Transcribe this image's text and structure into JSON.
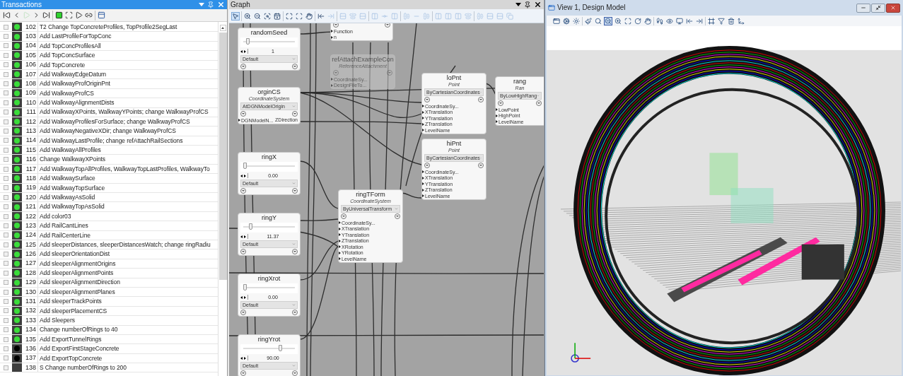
{
  "transactions": {
    "title": "Transactions",
    "toolbar": [
      {
        "disabled": false
      },
      {
        "disabled": false
      },
      {
        "disabled": true
      },
      {
        "disabled": false
      },
      {
        "disabled": false
      },
      {
        "disabled": false
      },
      {
        "disabled": false
      },
      {
        "disabled": false
      },
      {
        "disabled": false
      },
      {
        "disabled": false
      }
    ],
    "rows": [
      {
        "number": "102",
        "text": "T2 Change TopConcreteProfiles, TopProfile2SegLast",
        "color": "#3bdc3b"
      },
      {
        "number": "103",
        "text": "Add LastProfileForTopConc",
        "color": "#3bdc3b"
      },
      {
        "number": "104",
        "text": "Add TopConcProfilesAll",
        "color": "#3bdc3b"
      },
      {
        "number": "105",
        "text": "Add TopConcSurface",
        "color": "#3bdc3b"
      },
      {
        "number": "106",
        "text": "Add TopConcrete",
        "color": "#3bdc3b"
      },
      {
        "number": "107",
        "text": "Add WalkwayEdgeDatum",
        "color": "#3bdc3b"
      },
      {
        "number": "108",
        "text": "Add WalkwayProfOriginPnt",
        "color": "#3bdc3b"
      },
      {
        "number": "109",
        "text": "Add WalkwayProfCS",
        "color": "#3bdc3b"
      },
      {
        "number": "110",
        "text": "Add WalkwayAlignmentDists",
        "color": "#3bdc3b"
      },
      {
        "number": "111",
        "text": "Add WalkwayXPoints, WalkwayYPoints; change WalkwayProfCS",
        "color": "#3bdc3b"
      },
      {
        "number": "112",
        "text": "Add WalkwayProfilesForSurface; change WalkwayProfCS",
        "color": "#3bdc3b"
      },
      {
        "number": "113",
        "text": "Add WalkwayNegativeXDir; change WalkwayProfCS",
        "color": "#3bdc3b"
      },
      {
        "number": "114",
        "text": "Add WalkwayLastProfile; change refAttachRailSections",
        "color": "#3bdc3b"
      },
      {
        "number": "115",
        "text": "Add WalkwayAllProfiles",
        "color": "#3bdc3b"
      },
      {
        "number": "116",
        "text": "Change WalkwayXPoints",
        "color": "#3bdc3b"
      },
      {
        "number": "117",
        "text": "Add WalkwayTopAllProfiles, WalkwayTopLastProfiles, WalkwayTo",
        "color": "#3bdc3b"
      },
      {
        "number": "118",
        "text": "Add WalkwaySurface",
        "color": "#3bdc3b"
      },
      {
        "number": "119",
        "text": "Add WalkwayTopSurface",
        "color": "#3bdc3b"
      },
      {
        "number": "120",
        "text": "Add WalkwayAsSolid",
        "color": "#3bdc3b"
      },
      {
        "number": "121",
        "text": "Add WalkwayTopAsSolid",
        "color": "#3bdc3b"
      },
      {
        "number": "122",
        "text": "Add color03",
        "color": "#3bdc3b"
      },
      {
        "number": "123",
        "text": "Add RailCantLines",
        "color": "#3bdc3b"
      },
      {
        "number": "124",
        "text": "Add RailCenterLine",
        "color": "#3bdc3b"
      },
      {
        "number": "125",
        "text": "Add sleeperDistances, sleeperDistancesWatch; change ringRadiu",
        "color": "#3bdc3b"
      },
      {
        "number": "126",
        "text": "Add sleeperOrientationDist",
        "color": "#3bdc3b"
      },
      {
        "number": "127",
        "text": "Add sleeperAlignmentOrigins",
        "color": "#3bdc3b"
      },
      {
        "number": "128",
        "text": "Add sleeperAlignmentPoints",
        "color": "#3bdc3b"
      },
      {
        "number": "129",
        "text": "Add sleeperAlignmentDirection",
        "color": "#3bdc3b"
      },
      {
        "number": "130",
        "text": "Add sleeperAlignmentPlanes",
        "color": "#3bdc3b"
      },
      {
        "number": "131",
        "text": "Add sleeperTrackPoints",
        "color": "#3bdc3b"
      },
      {
        "number": "132",
        "text": "Add sleeperPlacementCS",
        "color": "#3bdc3b"
      },
      {
        "number": "133",
        "text": "Add Sleepers",
        "color": "#3bdc3b"
      },
      {
        "number": "134",
        "text": "Change numberOfRings to 40",
        "color": "#3bdc3b"
      },
      {
        "number": "135",
        "text": "Add ExportTunnelRings",
        "color": "#3bdc3b"
      },
      {
        "number": "136",
        "text": "Add ExportFirstStageConcrete",
        "color": "#000000"
      },
      {
        "number": "137",
        "text": "Add ExportTopConcrete",
        "color": "#000000"
      },
      {
        "number": "138",
        "text": "S Change numberOfRings to 200"
      }
    ]
  },
  "graph": {
    "title": "Graph",
    "toolbar": [
      {
        "selected": true,
        "disabled": false
      },
      {
        "selected": false,
        "disabled": false
      },
      {
        "selected": false,
        "disabled": false
      },
      {
        "selected": false,
        "disabled": false
      },
      {
        "selected": false,
        "disabled": false
      },
      {
        "selected": false,
        "disabled": false
      },
      {
        "selected": false,
        "disabled": false
      },
      {
        "selected": false,
        "disabled": false
      },
      {
        "selected": false,
        "disabled": false
      },
      {
        "selected": false,
        "disabled": true
      },
      {
        "selected": false,
        "disabled": true
      },
      {
        "selected": false,
        "disabled": true
      },
      {
        "selected": false,
        "disabled": true
      },
      {
        "selected": false,
        "disabled": true
      },
      {
        "selected": false,
        "disabled": true
      },
      {
        "selected": false,
        "disabled": true
      },
      {
        "selected": false,
        "disabled": true
      },
      {
        "selected": false,
        "disabled": true
      },
      {
        "selected": false,
        "disabled": true
      },
      {
        "selected": false,
        "disabled": true
      },
      {
        "selected": false,
        "disabled": true
      },
      {
        "selected": false,
        "disabled": true
      },
      {
        "selected": false,
        "disabled": true
      },
      {
        "selected": false,
        "disabled": true
      },
      {
        "selected": false,
        "disabled": true
      },
      {
        "selected": false,
        "disabled": true
      },
      {
        "selected": false,
        "disabled": true
      }
    ],
    "nodes": [
      {
        "kind": "slider",
        "title": "randomSeed",
        "disabled": false,
        "level": 0.05,
        "value": "1",
        "dropdown": "Default"
      },
      {
        "kind": "function",
        "title": "orginCS",
        "type": "CoordinateSystem",
        "disabled": false,
        "dropdown": "AtDGNModelOrigin",
        "inputs": [
          "DGNModelN..."
        ],
        "outputs": [
          "ZDirection"
        ]
      },
      {
        "kind": "slider",
        "title": "ringX",
        "disabled": false,
        "level": 0.0,
        "value": "0.00",
        "dropdown": "Default"
      },
      {
        "kind": "slider",
        "title": "ringY",
        "disabled": false,
        "level": 0.12,
        "value": "11.37",
        "dropdown": "Default"
      },
      {
        "kind": "slider",
        "title": "ringXrot",
        "disabled": false,
        "level": 0.0,
        "value": "0.00",
        "dropdown": "Default"
      },
      {
        "kind": "slider",
        "title": "ringYrot",
        "disabled": false,
        "level": 0.72,
        "value": "90.00",
        "dropdown": "Default"
      },
      {
        "kind": "function",
        "disabled": false,
        "inputs": [
          "Function",
          "n"
        ]
      },
      {
        "kind": "function",
        "title": "refAttachExampleCon",
        "type": "ReferenceAttachment",
        "disabled": true,
        "inputs": [
          "CoordinateSy...",
          "DesignFileTo..."
        ]
      },
      {
        "kind": "function",
        "title": "ringTForm",
        "type": "CoordinateSystem",
        "disabled": false,
        "dropdown": "ByUniversalTransform",
        "inputs": [
          "CoordinateSy...",
          "XTranslation",
          "YTranslation",
          "ZTranslation",
          "XRotation",
          "YRotation",
          "LevelName"
        ]
      },
      {
        "kind": "function",
        "title": "loPnt",
        "type": "Point",
        "disabled": false,
        "dropdown": "ByCartesianCoordinates",
        "inputs": [
          "CoordinateSy...",
          "XTranslation",
          "YTranslation",
          "ZTranslation",
          "LevelName"
        ]
      },
      {
        "kind": "function",
        "title": "hiPnt",
        "type": "Point",
        "disabled": false,
        "dropdown": "ByCartesianCoordinates",
        "inputs": [
          "CoordinateSy...",
          "XTranslation",
          "YTranslation",
          "ZTranslation",
          "LevelName"
        ]
      },
      {
        "kind": "function",
        "title": "rang",
        "type": "Ran",
        "disabled": false,
        "dropdown": "ByLowHighRang",
        "inputs": [
          "LowPoint",
          "HighPoint",
          "LevelName"
        ]
      }
    ]
  },
  "view": {
    "title": "View 1, Design Model",
    "toolbar": [
      {
        "selected": false
      },
      {
        "selected": false
      },
      {
        "selected": false
      },
      {
        "selected": false
      },
      {
        "selected": false
      },
      {
        "selected": true
      },
      {
        "selected": false
      },
      {
        "selected": false
      },
      {
        "selected": false
      },
      {
        "selected": false
      },
      {
        "selected": false
      },
      {
        "selected": false
      },
      {
        "selected": false
      },
      {
        "selected": false
      },
      {
        "selected": false
      },
      {
        "selected": false
      },
      {
        "selected": false
      },
      {
        "selected": false
      },
      {
        "selected": false
      }
    ]
  }
}
